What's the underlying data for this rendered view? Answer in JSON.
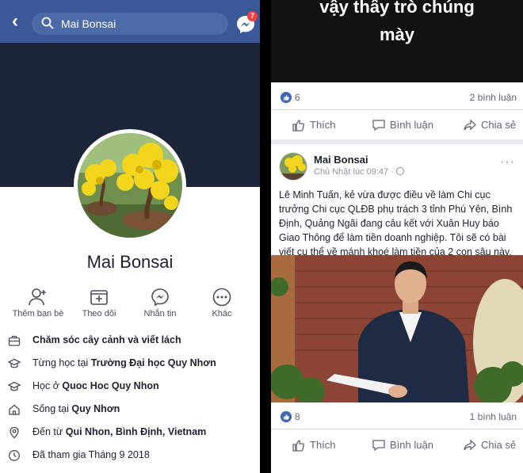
{
  "left": {
    "search": {
      "query": "Mai Bonsai"
    },
    "messenger_badge": "7",
    "profile_name": "Mai Bonsai",
    "actions": [
      {
        "label": "Thêm bạn bè",
        "icon": "add-friend-icon"
      },
      {
        "label": "Theo dõi",
        "icon": "follow-icon"
      },
      {
        "label": "Nhắn tin",
        "icon": "messenger-icon"
      },
      {
        "label": "Khác",
        "icon": "more-icon"
      }
    ],
    "intro": [
      {
        "icon": "briefcase-icon",
        "prefix": "",
        "bold": "Chăm sóc cây cảnh và viết lách"
      },
      {
        "icon": "graduation-cap-icon",
        "prefix": "Từng học tại ",
        "bold": "Trường Đại học Quy Nhơn"
      },
      {
        "icon": "graduation-cap-icon",
        "prefix": "Học ở ",
        "bold": "Quoc Hoc Quy Nhon"
      },
      {
        "icon": "home-icon",
        "prefix": "Sống tại ",
        "bold": "Quy Nhơn"
      },
      {
        "icon": "location-pin-icon",
        "prefix": "Đến từ ",
        "bold": "Qui Nhon, Bình Định, Vietnam"
      },
      {
        "icon": "clock-icon",
        "prefix": "Đã tham gia Tháng 9 2018",
        "bold": ""
      }
    ]
  },
  "right": {
    "video_caption_line1": "vậy thấy trò chúng",
    "video_caption_line2": "mày",
    "post1": {
      "reactions": "6",
      "comments": "2 bình luận"
    },
    "buttons": {
      "like": "Thích",
      "comment": "Bình luận",
      "share": "Chia sẻ"
    },
    "post2": {
      "author": "Mai Bonsai",
      "time": "Chủ Nhật lúc 09:47 ·",
      "more": "···",
      "text": "Lê Minh Tuấn, kẻ vừa được điều về làm Chi cục trưởng Chi cục QLĐB phụ trách 3 tỉnh Phú Yên, Bình Định, Quảng Ngãi đang câu kết với Xuân Huy báo Giao Thông để làm tiền doanh nghiệp. Tôi sẽ có bài viết cụ thể về mánh khoé làm tiền của 2 con sâu này.",
      "reactions": "8",
      "comments": "1 bình luận"
    }
  },
  "colors": {
    "facebook_blue": "#3b5998",
    "text_gray": "#606770",
    "like_blue": "#4267b2"
  }
}
